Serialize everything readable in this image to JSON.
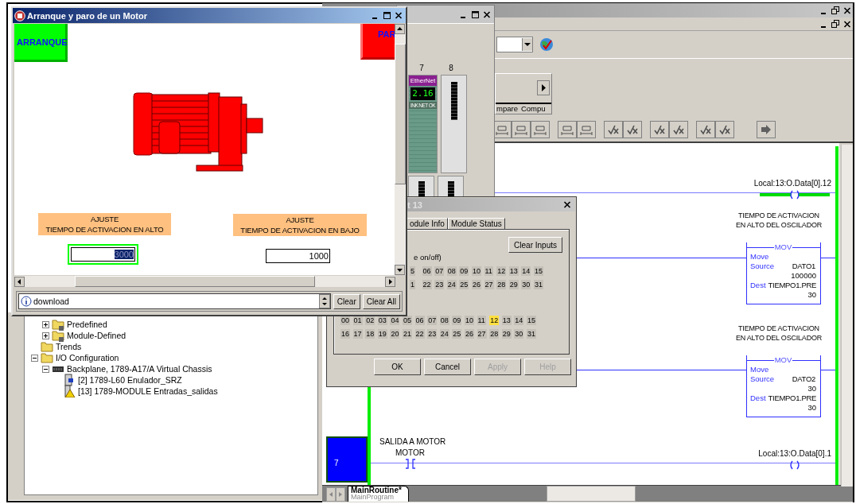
{
  "hmi_window": {
    "title": "Arranque y paro de un Motor",
    "start_button": "ARRANQUE",
    "stop_button": "PAR",
    "setpoints": [
      {
        "heading": "AJUSTE",
        "label": "TIEMPO DE ACTIVACION EN ALTO",
        "value": "3000",
        "selected": true
      },
      {
        "heading": "AJUSTE",
        "label": "TIEMPO DE ACTIVACION EN BAJO",
        "value": "1000",
        "selected": false
      }
    ],
    "status_message": "download",
    "buttons": [
      "Clear",
      "Clear All"
    ]
  },
  "chassis_window": {
    "slots": [
      {
        "number": "7",
        "kind": "ethernet",
        "module_label": "EtherNet",
        "display": "2.16",
        "leds": [
          "INK",
          "NET",
          "OK"
        ]
      },
      {
        "number": "8",
        "kind": "empty"
      }
    ]
  },
  "toolbar": {
    "instruction_tabs": [
      "mpare",
      "Compu"
    ]
  },
  "module_dialog": {
    "title": "t 13",
    "tabs": [
      {
        "label": "odule Info",
        "selected": false
      },
      {
        "label": "Module Status",
        "selected": false
      }
    ],
    "clear_button": "Clear Inputs",
    "input_caption": "e on/off)",
    "input_bits": [
      [
        {
          "label": "5",
          "on": false
        },
        {
          "label": "06",
          "on": false
        },
        {
          "label": "07",
          "on": false
        },
        {
          "label": "08",
          "on": false
        },
        {
          "label": "09",
          "on": false
        },
        {
          "label": "10",
          "on": false
        },
        {
          "label": "11",
          "on": false
        },
        {
          "label": "12",
          "on": false
        },
        {
          "label": "13",
          "on": false
        },
        {
          "label": "14",
          "on": false
        },
        {
          "label": "15",
          "on": false
        }
      ],
      [
        {
          "label": "1",
          "on": false
        },
        {
          "label": "22",
          "on": false
        },
        {
          "label": "23",
          "on": false
        },
        {
          "label": "24",
          "on": false
        },
        {
          "label": "25",
          "on": false
        },
        {
          "label": "26",
          "on": false
        },
        {
          "label": "27",
          "on": false
        },
        {
          "label": "28",
          "on": false
        },
        {
          "label": "29",
          "on": false
        },
        {
          "label": "30",
          "on": false
        },
        {
          "label": "31",
          "on": false
        }
      ]
    ],
    "output_bits": [
      [
        {
          "label": "00",
          "on": false
        },
        {
          "label": "01",
          "on": false
        },
        {
          "label": "02",
          "on": false
        },
        {
          "label": "03",
          "on": false
        },
        {
          "label": "04",
          "on": false
        },
        {
          "label": "05",
          "on": false
        },
        {
          "label": "06",
          "on": false
        },
        {
          "label": "07",
          "on": false
        },
        {
          "label": "08",
          "on": false
        },
        {
          "label": "09",
          "on": false
        },
        {
          "label": "10",
          "on": false
        },
        {
          "label": "11",
          "on": false
        },
        {
          "label": "12",
          "on": true
        },
        {
          "label": "13",
          "on": false
        },
        {
          "label": "14",
          "on": false
        },
        {
          "label": "15",
          "on": false
        }
      ],
      [
        {
          "label": "16",
          "on": false
        },
        {
          "label": "17",
          "on": false
        },
        {
          "label": "18",
          "on": false
        },
        {
          "label": "19",
          "on": false
        },
        {
          "label": "20",
          "on": false
        },
        {
          "label": "21",
          "on": false
        },
        {
          "label": "22",
          "on": false
        },
        {
          "label": "23",
          "on": false
        },
        {
          "label": "24",
          "on": false
        },
        {
          "label": "25",
          "on": false
        },
        {
          "label": "26",
          "on": false
        },
        {
          "label": "27",
          "on": false
        },
        {
          "label": "28",
          "on": false
        },
        {
          "label": "29",
          "on": false
        },
        {
          "label": "30",
          "on": false
        },
        {
          "label": "31",
          "on": false
        }
      ]
    ],
    "buttons": [
      {
        "label": "OK",
        "disabled": false
      },
      {
        "label": "Cancel",
        "disabled": false
      },
      {
        "label": "Apply",
        "disabled": true
      },
      {
        "label": "Help",
        "disabled": true
      }
    ]
  },
  "tree": [
    {
      "children": [
        {
          "label": "Predefined",
          "kind": "type-folder",
          "expanded": false
        },
        {
          "label": "Module-Defined",
          "kind": "type-folder",
          "expanded": false
        }
      ]
    },
    {
      "label": "Trends",
      "kind": "folder"
    },
    {
      "label": "I/O Configuration",
      "kind": "folder",
      "expanded": true,
      "children": [
        {
          "label": "Backplane, 1789-A17/A Virtual Chassis",
          "kind": "chassis",
          "expanded": true,
          "children": [
            {
              "label": "[2] 1789-L60 Enulador_SRZ",
              "kind": "controller"
            },
            {
              "label": "[13] 1789-MODULE Entradas_salidas",
              "kind": "module-warning"
            }
          ]
        }
      ]
    }
  ],
  "ladder": {
    "rungs": [
      {
        "kind": "coil",
        "coil": {
          "tag": "Local:13:O.Data[0].12",
          "energized": true
        }
      },
      {
        "kind": "mov",
        "comment": "TIEMPO DE ACTIVACION EN ALTO DEL OSCILADOR",
        "instruction": "MOV",
        "title": "Move",
        "source_label": "Source",
        "source_tag": "DATO1",
        "source_value": "100000",
        "dest_label": "Dest",
        "dest_tag": "TIEMPO1.PRE",
        "dest_value": "30"
      },
      {
        "kind": "mov",
        "comment": "TIEMPO DE ACTIVACION EN ALTO DEL OSCILADOR",
        "instruction": "MOV",
        "title": "Move",
        "source_label": "Source",
        "source_tag": "DATO2",
        "source_value": "30",
        "dest_label": "Dest",
        "dest_tag": "TIEMPO1.PRE",
        "dest_value": "30"
      },
      {
        "kind": "contact-coil",
        "number": "7",
        "selected": true,
        "comment": "SALIDA A MOTOR",
        "contact": {
          "tag": "MOTOR",
          "energized": false
        },
        "coil": {
          "tag": "Local:13:O.Data[0].1",
          "energized": false
        }
      }
    ]
  },
  "routine_tabs": [
    {
      "label": "MainRoutine*",
      "sublabel": "MainProgram",
      "selected": true
    }
  ]
}
